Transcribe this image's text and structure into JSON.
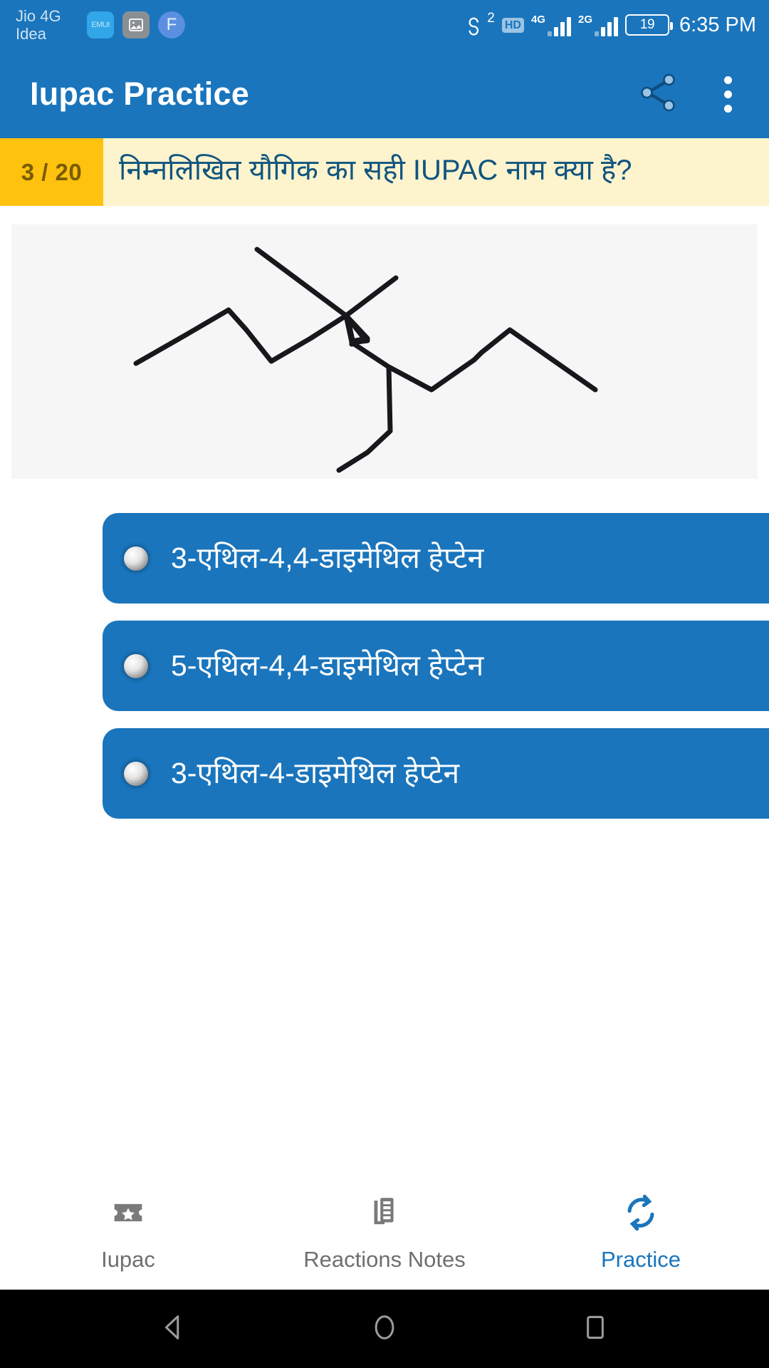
{
  "status_bar": {
    "carrier_line1": "Jio 4G",
    "carrier_line2": "Idea",
    "notification_icons": [
      "emui-icon",
      "gallery-icon",
      "facebook-icon"
    ],
    "emui_label": "EMUI",
    "facebook_label": "F",
    "sync_badge": "2",
    "hd_label": "HD",
    "sim1_network": "4G",
    "sim2_network": "2G",
    "battery_level": "19",
    "clock": "6:35 PM"
  },
  "app_bar": {
    "title": "Iupac Practice",
    "share_icon": "share-icon",
    "overflow_icon": "overflow-menu-icon"
  },
  "question": {
    "counter": "3 / 20",
    "text": "निम्नलिखित यौगिक का सही IUPAC नाम क्या है?",
    "counter_bg": "#ffc20e",
    "bar_bg": "#fdf3cd",
    "text_color": "#10557f"
  },
  "structure": {
    "caption": "skeletal-structure-of-3-ethyl-4,4-dimethylheptane",
    "background": "#f6f6f6",
    "stroke": "#17171c"
  },
  "options": [
    {
      "label": "3-एथिल-4,4-डाइमेथिल हेप्टेन",
      "selected": false
    },
    {
      "label": "5-एथिल-4,4-डाइमेथिल हेप्टेन",
      "selected": false
    },
    {
      "label": "3-एथिल-4-डाइमेथिल हेप्टेन",
      "selected": false
    }
  ],
  "bottom_nav": {
    "items": [
      {
        "label": "Iupac",
        "icon": "ticket-star-icon",
        "active": false
      },
      {
        "label": "Reactions Notes",
        "icon": "notes-document-icon",
        "active": false
      },
      {
        "label": "Practice",
        "icon": "refresh-sync-icon",
        "active": true
      }
    ],
    "active_color": "#1a75bc",
    "inactive_color": "#6f6f6f"
  },
  "android_nav": {
    "back_icon": "back-triangle-icon",
    "home_icon": "home-circle-icon",
    "recents_icon": "recents-square-icon"
  },
  "theme": {
    "primary": "#1a75bc",
    "accent": "#ffc20e",
    "option_bg": "#1a75bc"
  }
}
